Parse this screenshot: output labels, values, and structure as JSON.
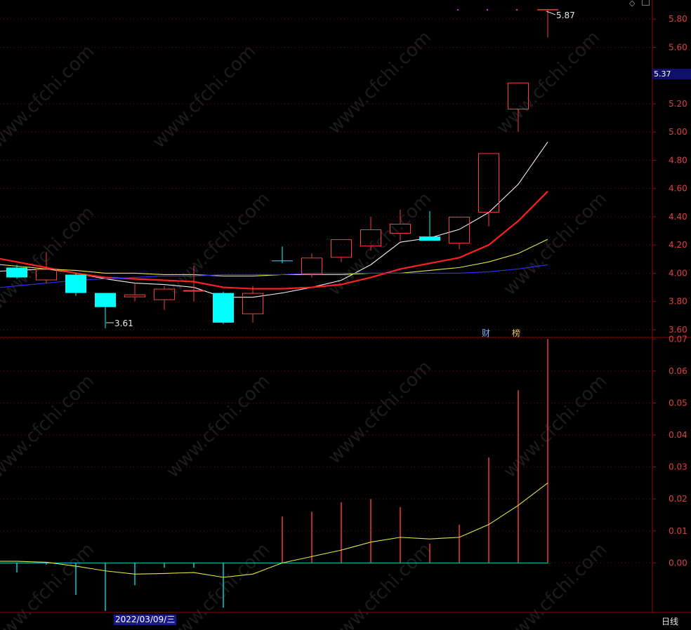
{
  "chart_data": {
    "type": "candlestick",
    "ui": {
      "current_price": "5.37",
      "cursor_date": "2022/03/09/三",
      "period": "日线",
      "high_marker": "5.87",
      "low_marker": "3.61",
      "tag_finance": "财",
      "tag_rank": "榜",
      "watermark": "www.cfchi.com"
    },
    "price_axis": {
      "ticks": [
        3.6,
        3.8,
        4.0,
        4.2,
        4.4,
        4.6,
        4.8,
        5.0,
        5.2,
        5.4,
        5.6,
        5.8
      ],
      "ylim": [
        3.545,
        5.935
      ]
    },
    "indicator_axis": {
      "ticks": [
        0.0,
        0.01,
        0.02,
        0.03,
        0.04,
        0.05,
        0.06,
        0.07
      ],
      "ylim": [
        -0.0155,
        0.0705
      ]
    },
    "candles": [
      {
        "o": 3.97,
        "h": 4.06,
        "l": 3.96,
        "c": 4.04,
        "color": "cyan"
      },
      {
        "o": 3.95,
        "h": 4.15,
        "l": 3.93,
        "c": 4.03,
        "color": "red"
      },
      {
        "o": 3.99,
        "h": 4.0,
        "l": 3.84,
        "c": 3.86,
        "color": "cyan"
      },
      {
        "o": 3.86,
        "h": 3.86,
        "l": 3.61,
        "c": 3.76,
        "color": "cyan"
      },
      {
        "o": 3.83,
        "h": 3.93,
        "l": 3.8,
        "c": 3.85,
        "color": "red"
      },
      {
        "o": 3.81,
        "h": 3.91,
        "l": 3.74,
        "c": 3.89,
        "color": "red"
      },
      {
        "o": 3.87,
        "h": 4.05,
        "l": 3.8,
        "c": 3.88,
        "color": "red"
      },
      {
        "o": 3.86,
        "h": 3.87,
        "l": 3.64,
        "c": 3.65,
        "color": "cyan"
      },
      {
        "o": 3.71,
        "h": 3.91,
        "l": 3.65,
        "c": 3.86,
        "color": "red"
      },
      {
        "o": 4.09,
        "h": 4.19,
        "l": 4.07,
        "c": 4.09,
        "color": "cyan"
      },
      {
        "o": 3.99,
        "h": 4.14,
        "l": 3.97,
        "c": 4.11,
        "color": "red"
      },
      {
        "o": 4.11,
        "h": 4.24,
        "l": 4.08,
        "c": 4.24,
        "color": "red"
      },
      {
        "o": 4.19,
        "h": 4.4,
        "l": 4.16,
        "c": 4.31,
        "color": "red"
      },
      {
        "o": 4.28,
        "h": 4.45,
        "l": 4.23,
        "c": 4.35,
        "color": "red"
      },
      {
        "o": 4.26,
        "h": 4.44,
        "l": 4.23,
        "c": 4.23,
        "color": "cyan"
      },
      {
        "o": 4.21,
        "h": 4.4,
        "l": 4.17,
        "c": 4.4,
        "color": "red"
      },
      {
        "o": 4.43,
        "h": 4.85,
        "l": 4.33,
        "c": 4.85,
        "color": "red"
      },
      {
        "o": 5.16,
        "h": 5.35,
        "l": 5.0,
        "c": 5.35,
        "color": "red"
      },
      {
        "o": 5.87,
        "h": 5.87,
        "l": 5.67,
        "c": 5.87,
        "color": "red"
      }
    ],
    "ma_series": [
      {
        "color": "#f0f0f0",
        "values": [
          4.02,
          4.03,
          4.0,
          3.96,
          3.93,
          3.92,
          3.9,
          3.83,
          3.83,
          3.86,
          3.9,
          3.95,
          4.06,
          4.22,
          4.25,
          4.31,
          4.43,
          4.63,
          4.93
        ]
      },
      {
        "color": "#ff2020",
        "values": [
          4.08,
          4.04,
          4.0,
          3.97,
          3.96,
          3.95,
          3.94,
          3.9,
          3.89,
          3.89,
          3.9,
          3.92,
          3.97,
          4.03,
          4.07,
          4.11,
          4.2,
          4.37,
          4.58
        ]
      },
      {
        "color": "#e6e640",
        "values": [
          4.05,
          4.03,
          4.02,
          4.0,
          4.0,
          3.99,
          3.99,
          3.98,
          3.98,
          3.99,
          3.99,
          3.99,
          4.0,
          4.0,
          4.02,
          4.04,
          4.08,
          4.14,
          4.24
        ]
      },
      {
        "color": "#3030ff",
        "values": [
          3.91,
          3.93,
          3.95,
          3.96,
          3.97,
          3.98,
          3.98,
          3.99,
          3.99,
          3.99,
          4.0,
          4.0,
          4.0,
          4.0,
          4.0,
          4.0,
          4.01,
          4.03,
          4.06
        ]
      }
    ],
    "indicator": {
      "bars": [
        -0.003,
        -0.0005,
        -0.01,
        -0.015,
        -0.007,
        -0.0015,
        -0.0015,
        -0.014,
        0.0,
        0.0145,
        0.016,
        0.019,
        0.02,
        0.0175,
        0.006,
        0.012,
        0.033,
        0.054,
        0.07
      ],
      "signal": [
        0.0005,
        0.0002,
        -0.001,
        -0.0025,
        -0.0035,
        -0.0033,
        -0.003,
        -0.0045,
        -0.0035,
        0.0,
        0.002,
        0.004,
        0.0065,
        0.008,
        0.0075,
        0.008,
        0.012,
        0.018,
        0.025
      ],
      "signal_x0": -0.5
    }
  }
}
